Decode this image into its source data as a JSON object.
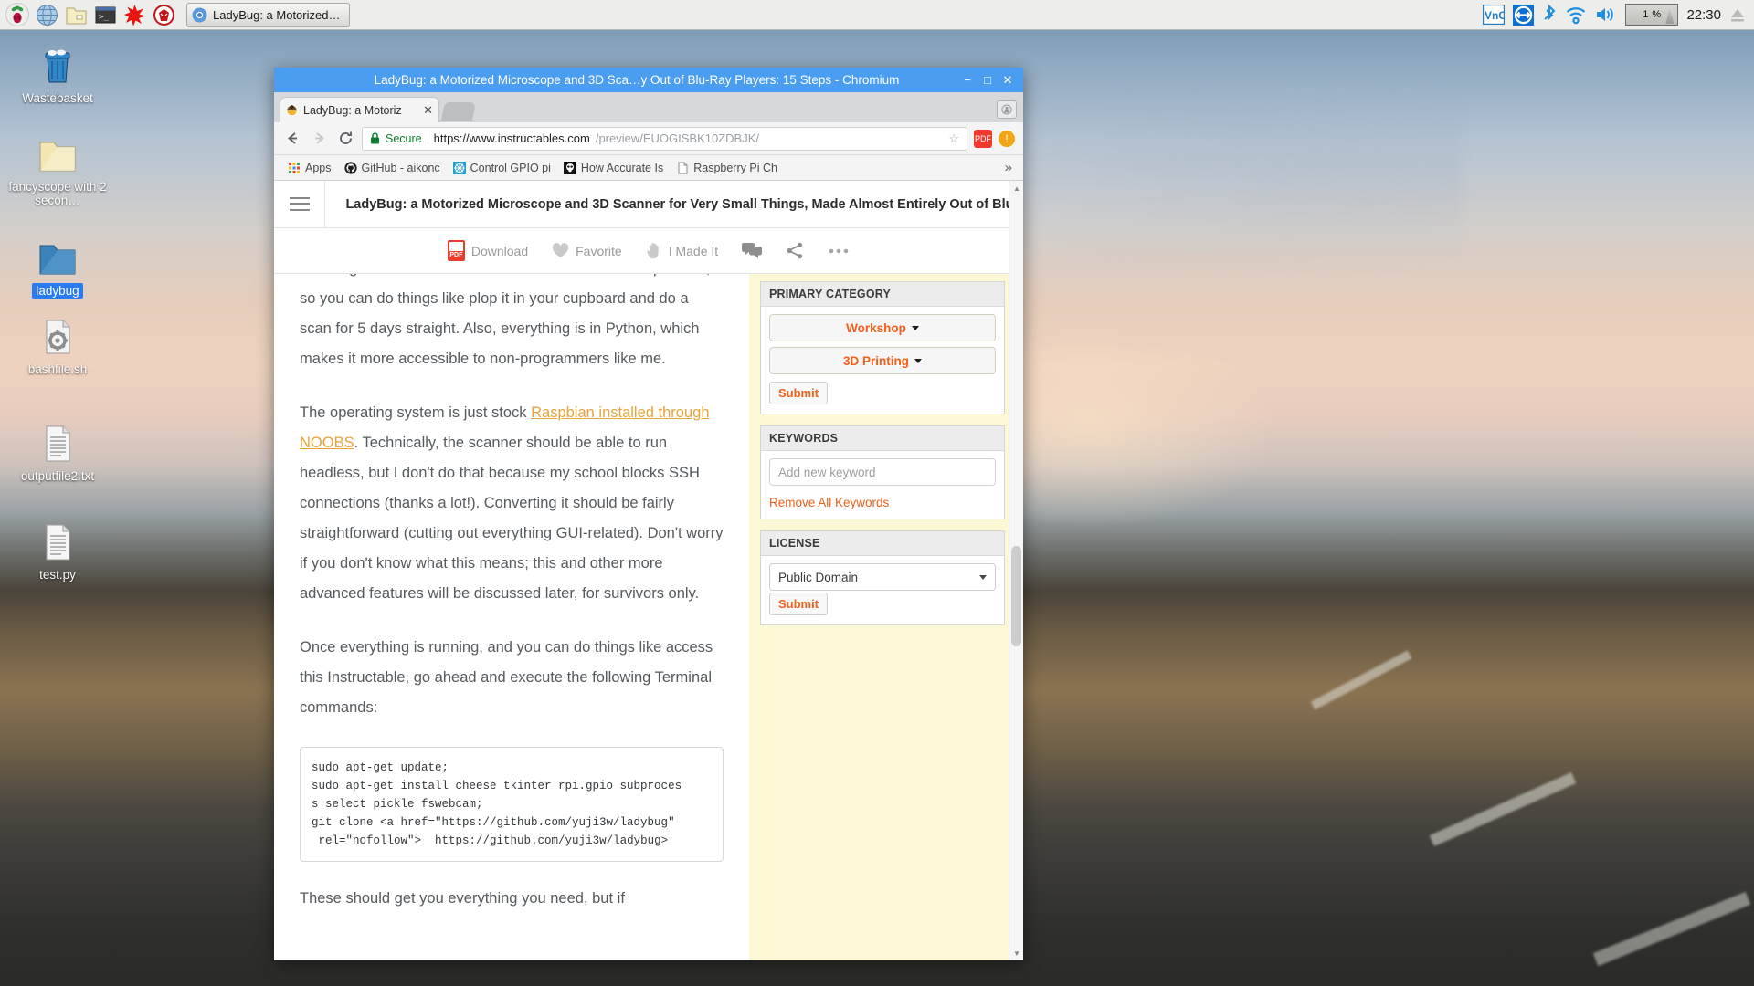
{
  "taskbar": {
    "launchers": [
      {
        "name": "raspberry-menu-icon",
        "label": "Raspberry Pi Menu"
      },
      {
        "name": "web-browser-icon",
        "label": "Web Browser"
      },
      {
        "name": "file-manager-icon",
        "label": "File Manager"
      },
      {
        "name": "terminal-icon",
        "label": "Terminal"
      },
      {
        "name": "mathematica-icon",
        "label": "Mathematica"
      },
      {
        "name": "wolfram-icon",
        "label": "Wolfram"
      }
    ],
    "window_buttons": [
      {
        "name": "taskbar-window-chromium",
        "label": "LadyBug: a Motorized…",
        "icon": "chromium-icon"
      }
    ],
    "tray": {
      "vnc_label": "VNC",
      "cpu_label": "1 %",
      "clock": "22:30",
      "icons": [
        "vnc-icon",
        "teamviewer-icon",
        "bluetooth-icon",
        "wifi-icon",
        "volume-icon",
        "cpu-monitor",
        "eject-icon"
      ]
    }
  },
  "desktop": {
    "icons": [
      {
        "label": "Wastebasket",
        "type": "trash",
        "selected": false
      },
      {
        "label": "fancyscope with 2 secon…",
        "type": "folder-cream",
        "selected": false
      },
      {
        "label": "ladybug",
        "type": "folder-blue",
        "selected": true
      },
      {
        "label": "bashfile.sh",
        "type": "script",
        "selected": false
      },
      {
        "label": "outputfile2.txt",
        "type": "text",
        "selected": false
      },
      {
        "label": "test.py",
        "type": "text",
        "selected": false
      }
    ]
  },
  "browser": {
    "window_title": "LadyBug: a Motorized Microscope and 3D Sca…y Out of Blu-Ray Players: 15 Steps - Chromium",
    "minimize": "−",
    "maximize": "□",
    "close": "✕",
    "tab": {
      "title": "LadyBug: a Motoriz",
      "close": "✕",
      "favicon": "ladybug-favicon"
    },
    "omnibox": {
      "secure_label": "Secure",
      "url_strong": "https://www.instructables.com",
      "url_dim": "/preview/EUOGISBK10ZDBJK/",
      "star": "☆",
      "extension_badge": "PDF",
      "update_badge": "!"
    },
    "bookmarks": [
      {
        "label": "Apps",
        "icon": "apps-grid-icon"
      },
      {
        "label": "GitHub - aikonc",
        "icon": "github-icon"
      },
      {
        "label": "Control GPIO pi",
        "icon": "gpio-icon"
      },
      {
        "label": "How Accurate Is",
        "icon": "skull-icon"
      },
      {
        "label": "Raspberry Pi Ch",
        "icon": "page-icon"
      }
    ],
    "bookmarks_overflow": "»"
  },
  "page": {
    "header_title": "LadyBug: a Motorized Microscope and 3D Scanner for Very Small Things, Made Almost Entirely Out of Blu-Ray",
    "actions": [
      {
        "label": "Download",
        "icon": "pdf-icon"
      },
      {
        "label": "Favorite",
        "icon": "heart-icon"
      },
      {
        "label": "I Made It",
        "icon": "hand-icon"
      },
      {
        "label": "",
        "icon": "comment-icon"
      },
      {
        "label": "",
        "icon": "share-icon"
      },
      {
        "label": "",
        "icon": "more-icon"
      }
    ],
    "article": {
      "paragraph_1": "the thing that moves the motors takes and saves the pictures, so you can do things like plop it in your cupboard and do a scan for 5 days straight. Also, everything is in Python, which makes it more accessible to non-programmers like me.",
      "paragraph_2_pre": "The operating system is just stock ",
      "paragraph_2_link": "Raspbian installed through NOOBS",
      "paragraph_2_post": ". Technically, the scanner should be able to run headless, but I don't do that because my school blocks SSH connections (thanks a lot!). Converting it should be fairly straightforward (cutting out everything GUI-related). Don't worry if you don't know what this means; this and other more advanced features will be discussed later, for survivors only.",
      "paragraph_3": "Once everything is running, and you can do things like access this Instructable, go ahead and execute the following Terminal commands:",
      "code": "sudo apt-get update;\nsudo apt-get install cheese tkinter rpi.gpio subproces\ns select pickle fswebcam;\ngit clone <a href=\"https://github.com/yuji3w/ladybug\"\n rel=\"nofollow\">  https://github.com/yuji3w/ladybug>",
      "paragraph_4": "These should get you everything you need, but if"
    },
    "sidebar": {
      "primary_category": {
        "title": "PRIMARY CATEGORY",
        "option_1": "Workshop",
        "option_2": "3D Printing",
        "submit": "Submit"
      },
      "keywords": {
        "title": "KEYWORDS",
        "placeholder": "Add new keyword",
        "remove_all": "Remove All Keywords"
      },
      "license": {
        "title": "LICENSE",
        "value": "Public Domain",
        "submit": "Submit"
      }
    }
  },
  "colors": {
    "titlebar_blue": "#4b9df0",
    "accent_orange": "#f0601b",
    "link_orange": "#e8a33d",
    "sidebar_yellow": "#fcf8d6",
    "secure_green": "#0a7c2f",
    "selection_blue": "#2a7bf0"
  }
}
